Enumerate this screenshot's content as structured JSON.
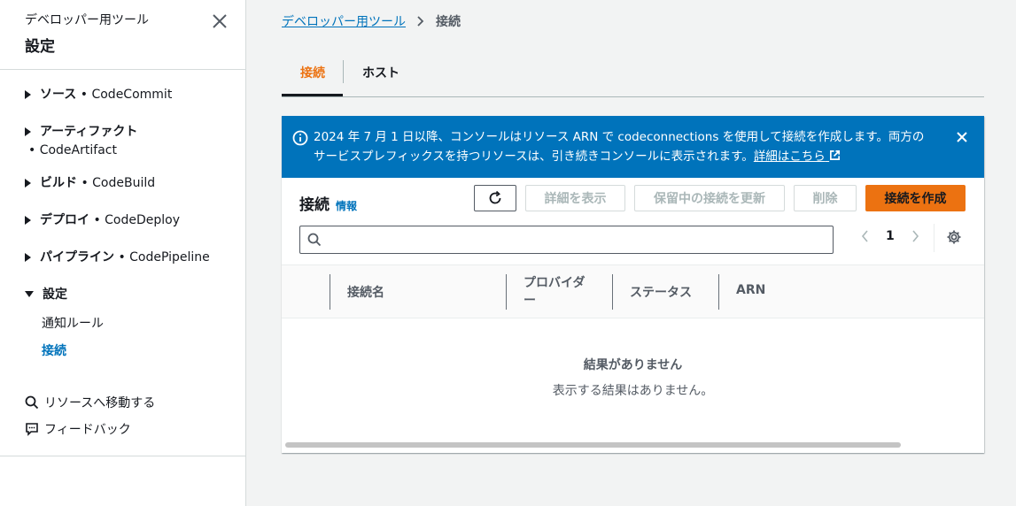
{
  "sidebar": {
    "subtitle": "デベロッパー用ツール",
    "title": "設定",
    "items": [
      {
        "label": "ソース",
        "service": " • CodeCommit"
      },
      {
        "label": "アーティファクト",
        "service": "• CodeArtifact"
      },
      {
        "label": "ビルド",
        "service": " • CodeBuild"
      },
      {
        "label": "デプロイ",
        "service": " • CodeDeploy"
      },
      {
        "label": "パイプライン",
        "service": " • CodePipeline"
      },
      {
        "label": "設定"
      }
    ],
    "sub_items": [
      "通知ルール",
      "接続"
    ],
    "utilities": [
      "リソースへ移動する",
      "フィードバック"
    ]
  },
  "breadcrumb": {
    "parent": "デベロッパー用ツール",
    "current": "接続"
  },
  "tabs": [
    "接続",
    "ホスト"
  ],
  "flash": {
    "text": "2024 年 7 月 1 日以降、コンソールはリソース ARN で codeconnections を使用して接続を作成します。両方のサービスプレフィックスを持つリソースは、引き続きコンソールに表示されます。",
    "link": "詳細はこちら"
  },
  "table": {
    "title": "接続",
    "info": "情報",
    "buttons": {
      "detail": "詳細を表示",
      "update": "保留中の接続を更新",
      "delete": "削除",
      "create": "接続を作成"
    },
    "search_value": "",
    "page": "1",
    "columns": [
      "接続名",
      "プロバイダー",
      "ステータス",
      "ARN"
    ],
    "empty_title": "結果がありません",
    "empty_sub": "表示する結果はありません。"
  },
  "colors": {
    "accent": "#ec7211",
    "link": "#0073bb",
    "flash_bg": "#0073bb"
  }
}
